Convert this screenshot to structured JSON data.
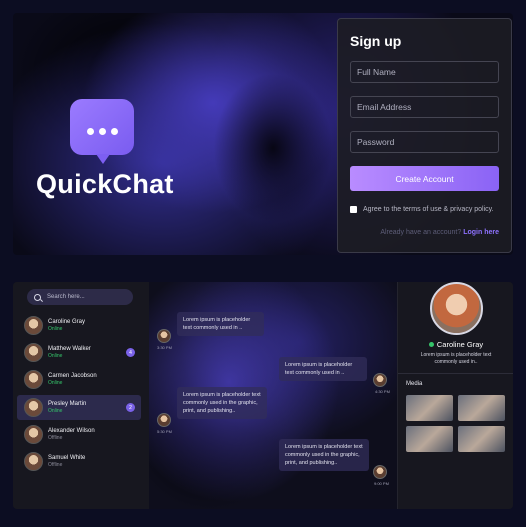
{
  "brand": {
    "name": "QuickChat"
  },
  "signup": {
    "title": "Sign up",
    "full_name_placeholder": "Full Name",
    "email_placeholder": "Email Address",
    "password_placeholder": "Password",
    "create_button": "Create Account",
    "terms_text": "Agree to the terms of use & privacy policy.",
    "login_prompt": "Already have an account?",
    "login_link": "Login here"
  },
  "sidebar": {
    "search_placeholder": "Search here...",
    "contacts": [
      {
        "name": "Caroline Gray",
        "status": "Online",
        "unread": ""
      },
      {
        "name": "Matthew Walker",
        "status": "Online",
        "unread": "4"
      },
      {
        "name": "Carmen Jacobson",
        "status": "Online",
        "unread": ""
      },
      {
        "name": "Presley Martin",
        "status": "Online",
        "unread": "2"
      },
      {
        "name": "Alexander Wilson",
        "status": "Offline",
        "unread": ""
      },
      {
        "name": "Samuel White",
        "status": "Offline",
        "unread": ""
      }
    ]
  },
  "chat": {
    "messages": [
      {
        "text": "Lorem ipsum is placeholder text commonly used in ..",
        "time": "3:30 PM"
      },
      {
        "text": "Lorem ipsum is placeholder text commonly used in ..",
        "time": "4:30 PM"
      },
      {
        "text": "Lorem ipsum is placeholder text commonly used in the graphic, print, and publishing..",
        "time": "5:30 PM"
      },
      {
        "text": "Lorem ipsum is placeholder text commonly used in the graphic, print, and publishing..",
        "time": "9:00 PM"
      }
    ]
  },
  "profile": {
    "name": "Caroline Gray",
    "description": "Lorem ipsum is placeholder text commonly used in..",
    "media_title": "Media"
  },
  "colors": {
    "accent": "#8a63f5",
    "online": "#35c46a",
    "background": "#0c0d22"
  }
}
